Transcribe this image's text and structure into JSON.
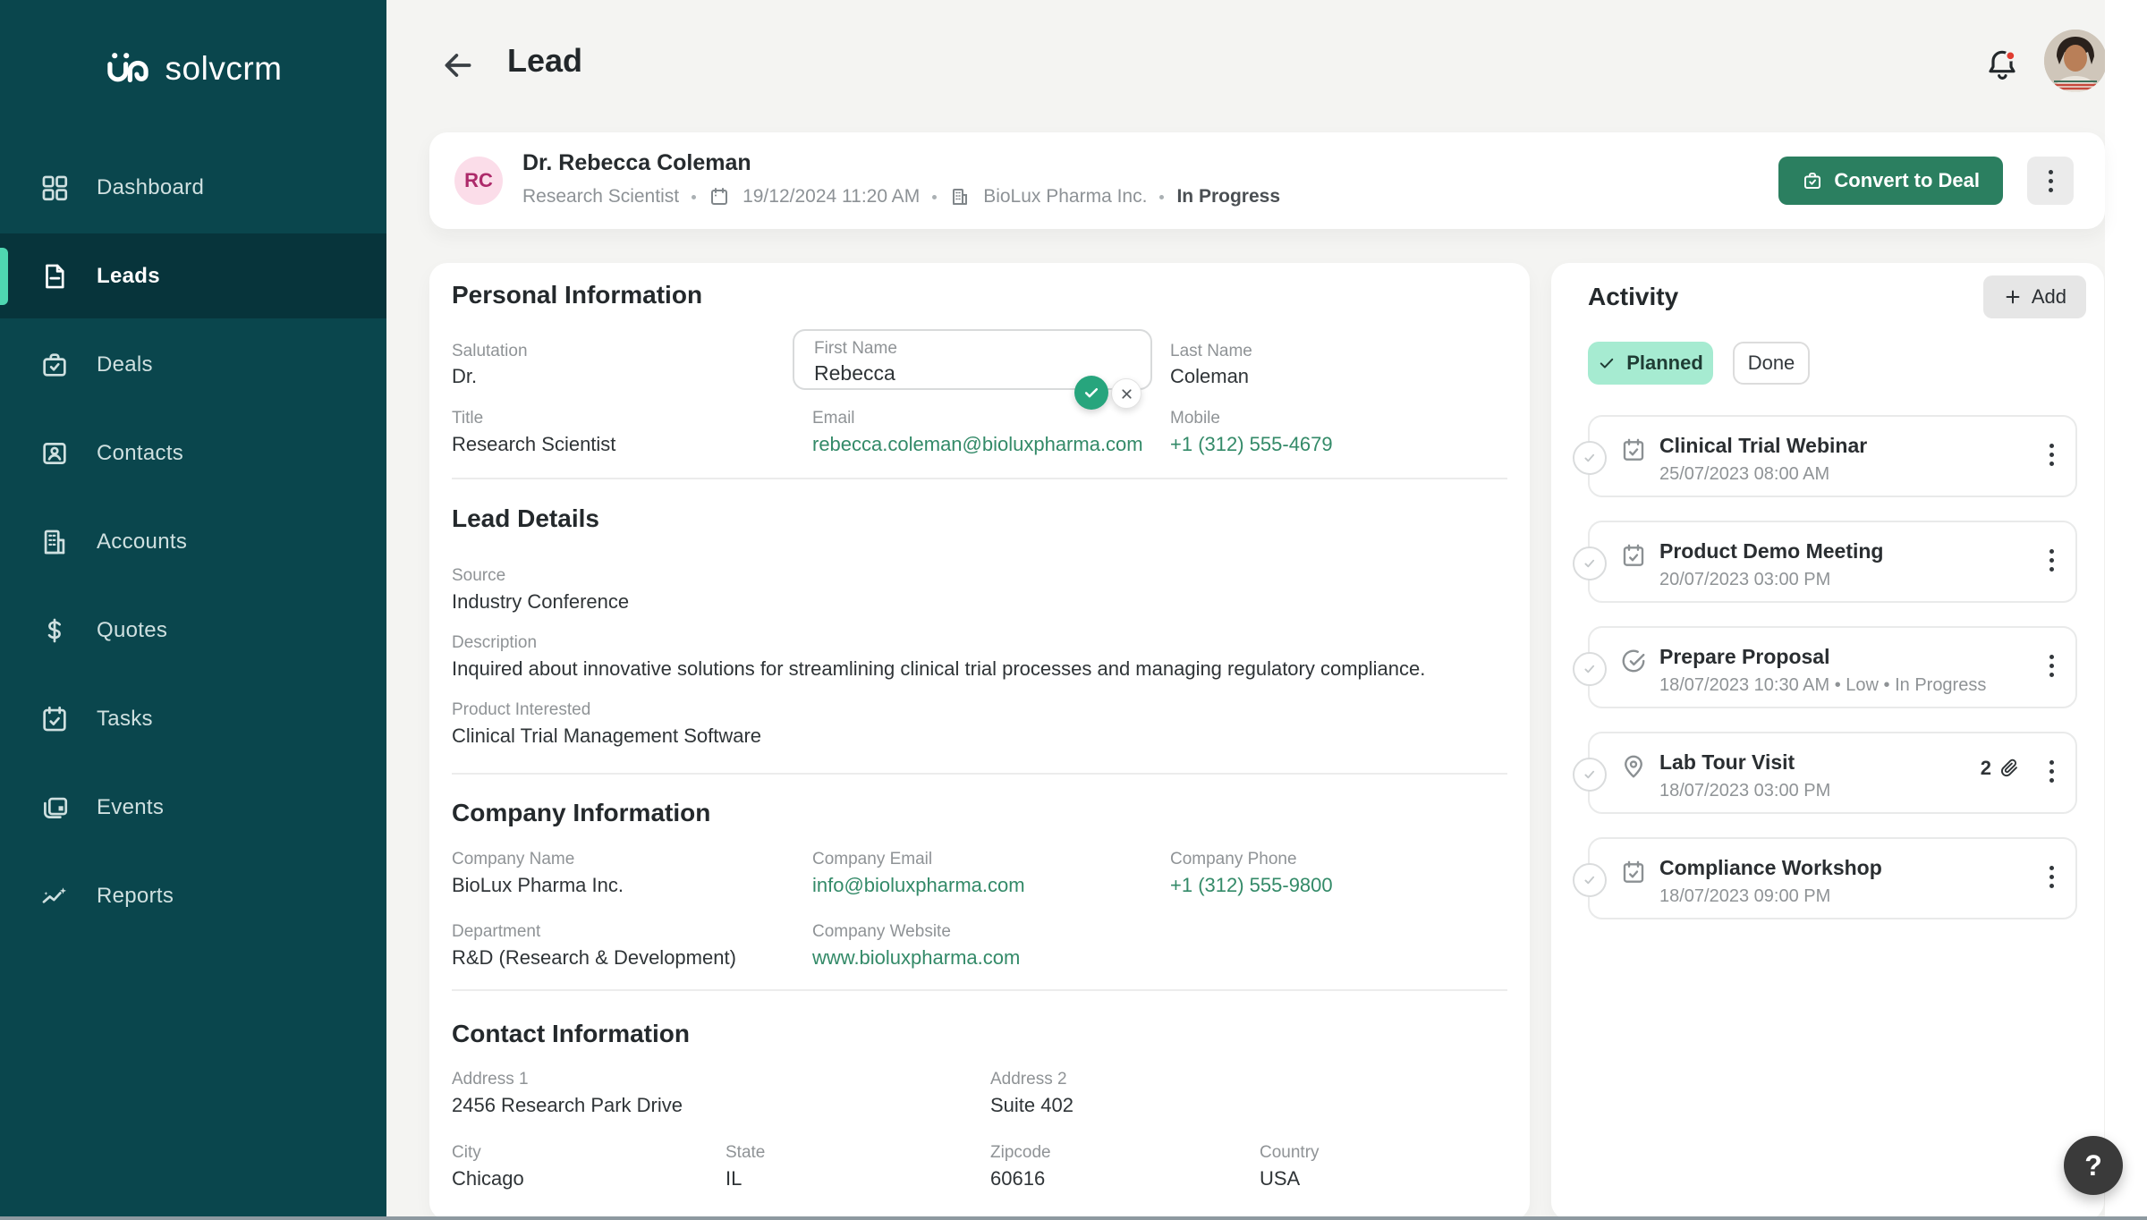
{
  "app": {
    "logo_text": "solvcrm"
  },
  "sidebar": {
    "items": [
      {
        "label": "Dashboard"
      },
      {
        "label": "Leads"
      },
      {
        "label": "Deals"
      },
      {
        "label": "Contacts"
      },
      {
        "label": "Accounts"
      },
      {
        "label": "Quotes"
      },
      {
        "label": "Tasks"
      },
      {
        "label": "Events"
      },
      {
        "label": "Reports"
      }
    ],
    "active_item": "Leads"
  },
  "header": {
    "title": "Lead"
  },
  "lead": {
    "initials": "RC",
    "name": "Dr. Rebecca Coleman",
    "job_title": "Research Scientist",
    "created": "19/12/2024 11:20 AM",
    "company": "BioLux Pharma Inc.",
    "status": "In Progress",
    "convert_label": "Convert to Deal"
  },
  "personal": {
    "heading": "Personal Information",
    "salutation_label": "Salutation",
    "salutation": "Dr.",
    "first_name_label": "First Name",
    "first_name": "Rebecca",
    "last_name_label": "Last Name",
    "last_name": "Coleman",
    "title_label": "Title",
    "title": "Research Scientist",
    "email_label": "Email",
    "email": "rebecca.coleman@bioluxpharma.com",
    "mobile_label": "Mobile",
    "mobile": "+1 (312) 555-4679"
  },
  "lead_details": {
    "heading": "Lead Details",
    "source_label": "Source",
    "source": "Industry Conference",
    "description_label": "Description",
    "description": "Inquired about innovative solutions for streamlining clinical trial processes and managing regulatory compliance.",
    "product_label": "Product Interested",
    "product": "Clinical Trial Management Software"
  },
  "company": {
    "heading": "Company Information",
    "name_label": "Company Name",
    "name": "BioLux Pharma Inc.",
    "email_label": "Company Email",
    "email": "info@bioluxpharma.com",
    "phone_label": "Company Phone",
    "phone": "+1 (312) 555-9800",
    "department_label": "Department",
    "department": "R&D (Research & Development)",
    "website_label": "Company Website",
    "website": "www.bioluxpharma.com"
  },
  "contact": {
    "heading": "Contact Information",
    "address1_label": "Address 1",
    "address1": "2456 Research Park Drive",
    "address2_label": "Address 2",
    "address2": "Suite 402",
    "city_label": "City",
    "city": "Chicago",
    "state_label": "State",
    "state": "IL",
    "zipcode_label": "Zipcode",
    "zipcode": "60616",
    "country_label": "Country",
    "country": "USA"
  },
  "activity": {
    "heading": "Activity",
    "add_label": "Add",
    "tabs": {
      "planned": "Planned",
      "done": "Done"
    },
    "items": [
      {
        "icon": "calendar-check",
        "title": "Clinical Trial Webinar",
        "meta": "25/07/2023 08:00 AM"
      },
      {
        "icon": "calendar-check",
        "title": "Product Demo Meeting",
        "meta": "20/07/2023 03:00 PM"
      },
      {
        "icon": "task-check",
        "title": "Prepare Proposal",
        "meta": "18/07/2023 10:30 AM  •  Low  •  In Progress"
      },
      {
        "icon": "map-pin",
        "title": "Lab Tour Visit",
        "meta": "18/07/2023 03:00 PM",
        "attachments": "2"
      },
      {
        "icon": "calendar-check",
        "title": "Compliance Workshop",
        "meta": "18/07/2023 09:00 PM"
      }
    ]
  },
  "help": {
    "label": "?"
  },
  "colors": {
    "sidebar_teal": "#0a464d",
    "accent_green": "#2b7f60",
    "confirm_green": "#27a57d",
    "link_teal": "#338a68",
    "planned_mint": "#a6ebd1",
    "avatar_pink_bg": "#fbdde9",
    "avatar_pink_text": "#ad2a6a",
    "notification_red": "#e03c31",
    "active_indicator_mint": "#4fd6b1"
  }
}
